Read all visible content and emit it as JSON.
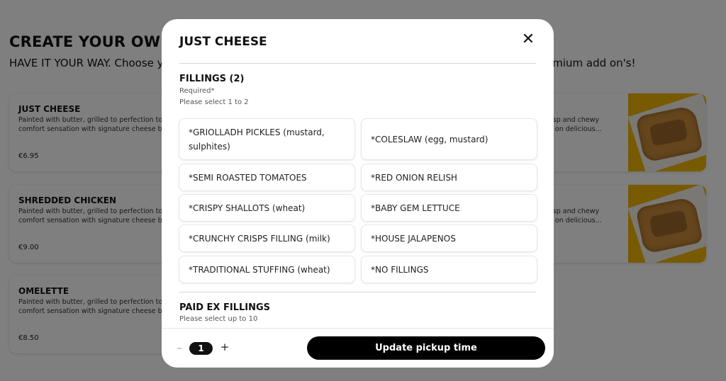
{
  "background": {
    "title": "CREATE YOUR OWN T",
    "subtitle": "HAVE IT YOUR WAY. Choose yo",
    "subtitle_right": "emium add on's!",
    "items": [
      {
        "name": "JUST CHEESE",
        "desc_line1": "Painted with butter, grilled to perfection to",
        "desc_line2": "comfort sensation with signature cheese b",
        "price": "€6.95",
        "right_desc_line1": "crisp and chewy",
        "right_desc_line2": "ed on delicious..."
      },
      {
        "name": "SHREDDED CHICKEN",
        "desc_line1": "Painted with butter, grilled to perfection to",
        "desc_line2": "comfort sensation with signature cheese b",
        "price": "€9.00",
        "right_desc_line1": "crisp and chewy",
        "right_desc_line2": "ed on delicious..."
      },
      {
        "name": "OMELETTE",
        "desc_line1": "Painted with butter, grilled to perfection to",
        "desc_line2": "comfort sensation with signature cheese b",
        "price": "€8.50"
      }
    ]
  },
  "modal": {
    "title": "JUST CHEESE",
    "close_icon": "close-icon",
    "fillings": {
      "title": "FILLINGS (2)",
      "required": "Required*",
      "instruction": "Please select 1 to 2",
      "options": [
        "*GRIOLLADH PICKLES (mustard, sulphites)",
        "*COLESLAW (egg, mustard)",
        "*SEMI ROASTED TOMATOES",
        "*RED ONION RELISH",
        "*CRISPY SHALLOTS (wheat)",
        "*BABY GEM LETTUCE",
        "*CRUNCHY CRISPS FILLING (milk)",
        "*HOUSE JALAPENOS",
        "*TRADITIONAL STUFFING (wheat)",
        "*NO FILLINGS"
      ]
    },
    "paid_fillings": {
      "title": "PAID EX FILLINGS",
      "instruction": "Please select up to 10"
    },
    "quantity": {
      "minus": "–",
      "value": "1",
      "plus": "+"
    },
    "primary_button": "Update pickup time"
  },
  "colors": {
    "overlay": "#000000",
    "button": "#000000",
    "image_bg": "#f0b400"
  }
}
